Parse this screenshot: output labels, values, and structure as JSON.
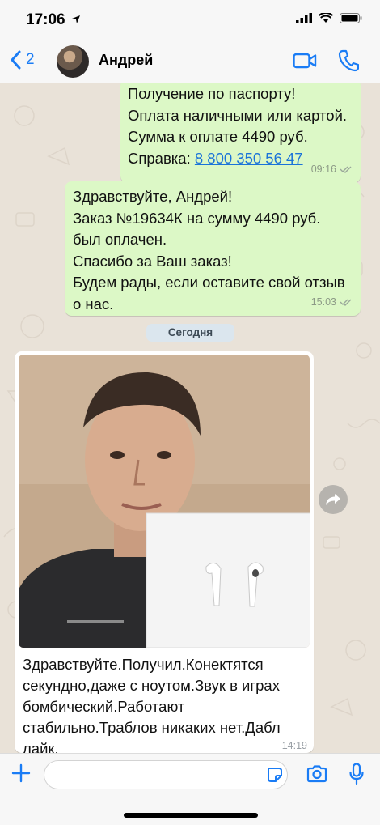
{
  "status_bar": {
    "time": "17:06"
  },
  "header": {
    "back_count": "2",
    "contact_name": "Андрей"
  },
  "messages": [
    {
      "direction": "outgoing",
      "lines": [
        "Получение по паспорту!",
        "Оплата наличными или картой.",
        "Сумма к оплате 4490 руб."
      ],
      "link_prefix": "Справка: ",
      "link_text": "8 800 350 56 47",
      "time": "09:16"
    },
    {
      "direction": "outgoing",
      "lines": [
        "Здравствуйте, Андрей!",
        "Заказ №19634К на сумму 4490 руб.",
        "был оплачен.",
        "Спасибо за Ваш заказ!",
        "Будем рады, если оставите свой отзыв",
        "о нас."
      ],
      "time": "15:03"
    }
  ],
  "date_divider": "Сегодня",
  "incoming": {
    "photo_icon": "airpods-photo",
    "caption_lines": [
      "Здравствуйте.Получил.Конектятся",
      "секундно,даже с ноутом.Звук в играх",
      "бомбический.Работают",
      "стабильно.Траблов никаких нет.Дабл",
      "лайк."
    ],
    "time": "14:19"
  },
  "input": {
    "placeholder": ""
  },
  "colors": {
    "accent": "#1a7cf5",
    "outgoing_bubble": "#dcf8c6",
    "incoming_bubble": "#ffffff",
    "chat_bg": "#e9e2d8"
  }
}
